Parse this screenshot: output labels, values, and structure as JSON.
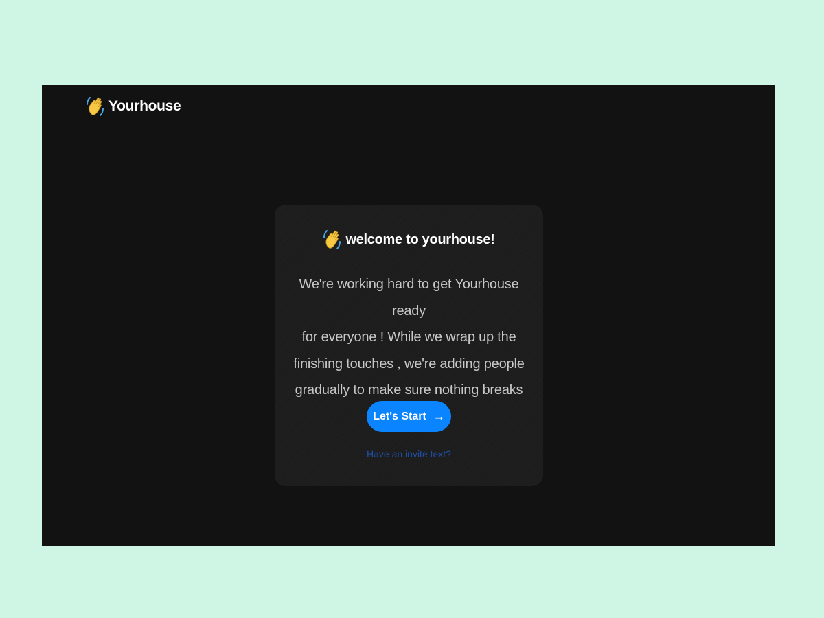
{
  "header": {
    "brand_name": "Yourhouse",
    "brand_icon": "waving-hand-icon"
  },
  "welcome_card": {
    "title": "welcome to yourhouse!",
    "title_icon": "waving-hand-icon",
    "body_lines": [
      "We're working hard to get Yourhouse ready",
      "for everyone ! While we wrap up the",
      "finishing touches , we're adding people",
      "gradually to make sure nothing breaks"
    ],
    "start_button": {
      "label": "Let's Start",
      "icon": "arrow-right-icon"
    },
    "invite_link": "Have an invite text?"
  },
  "colors": {
    "page_background": "#cff5e5",
    "app_background": "#121212",
    "card_background": "#1c1c1c",
    "accent": "#0a84ff",
    "link": "#1e4fa8"
  }
}
